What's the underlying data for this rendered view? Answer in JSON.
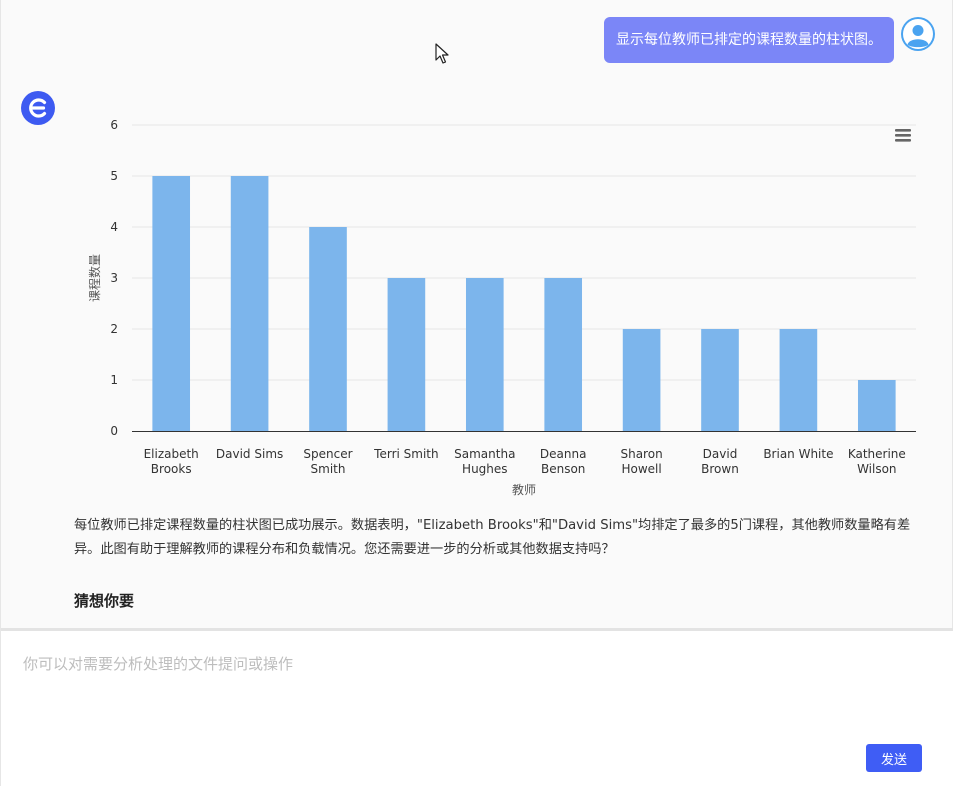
{
  "user_message": "显示每位教师已排定的课程数量的柱状图。",
  "colors": {
    "user_bubble": "#7b86f7",
    "bar": "#7cb5ec",
    "send_button": "#3f5df5",
    "avatar": "#3d5af1",
    "user_avatar": "#4aa3f0"
  },
  "icons": {
    "bot": "e-logo-icon",
    "user": "user-avatar-icon",
    "menu": "hamburger-menu-icon"
  },
  "chart_data": {
    "type": "bar",
    "categories": [
      "Elizabeth Brooks",
      "David Sims",
      "Spencer Smith",
      "Terri Smith",
      "Samantha Hughes",
      "Deanna Benson",
      "Sharon Howell",
      "David Brown",
      "Brian White",
      "Katherine Wilson"
    ],
    "category_label_lines": [
      [
        "Elizabeth",
        "Brooks"
      ],
      [
        "David Sims"
      ],
      [
        "Spencer",
        "Smith"
      ],
      [
        "Terri Smith"
      ],
      [
        "Samantha",
        "Hughes"
      ],
      [
        "Deanna",
        "Benson"
      ],
      [
        "Sharon",
        "Howell"
      ],
      [
        "David",
        "Brown"
      ],
      [
        "Brian White"
      ],
      [
        "Katherine",
        "Wilson"
      ]
    ],
    "values": [
      5,
      5,
      4,
      3,
      3,
      3,
      2,
      2,
      2,
      1
    ],
    "xlabel": "教师",
    "ylabel": "课程数量",
    "ylim": [
      0,
      6
    ],
    "yticks": [
      0,
      1,
      2,
      3,
      4,
      5,
      6
    ],
    "grid": true,
    "legend": "none"
  },
  "reply": {
    "text": "每位教师已排定课程数量的柱状图已成功展示。数据表明，\"Elizabeth Brooks\"和\"David Sims\"均排定了最多的5门课程，其他教师数量略有差异。此图有助于理解教师的课程分布和负载情况。您还需要进一步的分析或其他数据支持吗？"
  },
  "suggestions": {
    "title": "猜想你要"
  },
  "input": {
    "placeholder": "你可以对需要分析处理的文件提问或操作",
    "value": ""
  },
  "send_button": {
    "label": "发送"
  }
}
